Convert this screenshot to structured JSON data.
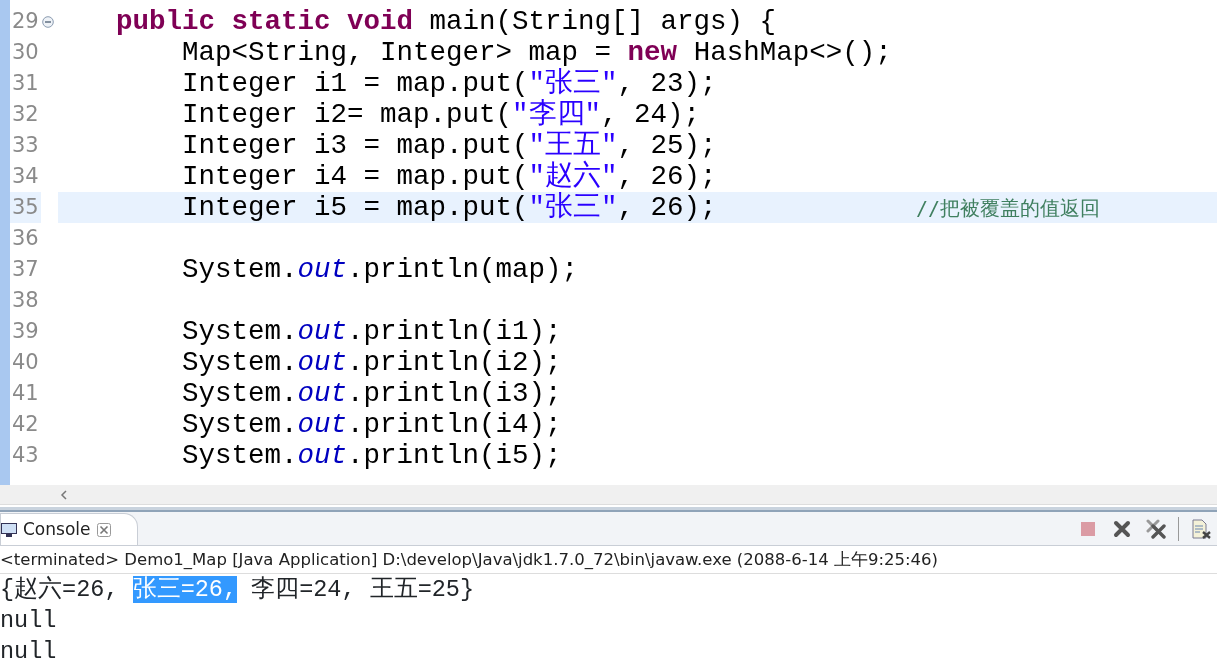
{
  "editor": {
    "lines": [
      {
        "number": "29",
        "expanded": true,
        "current": false,
        "tokens": [
          {
            "kind": "keyword",
            "text": "    public static void"
          },
          {
            "kind": "plain",
            "text": " main(String[] args) {"
          }
        ]
      },
      {
        "number": "30",
        "current": false,
        "tokens": [
          {
            "kind": "plain",
            "text": "        Map<String, Integer> map = "
          },
          {
            "kind": "keyword",
            "text": "new"
          },
          {
            "kind": "plain",
            "text": " HashMap<>();"
          }
        ]
      },
      {
        "number": "31",
        "current": false,
        "tokens": [
          {
            "kind": "plain",
            "text": "        Integer i1 = map.put("
          },
          {
            "kind": "string",
            "text": "\"张三\""
          },
          {
            "kind": "plain",
            "text": ", 23);"
          }
        ]
      },
      {
        "number": "32",
        "current": false,
        "tokens": [
          {
            "kind": "plain",
            "text": "        Integer i2= map.put("
          },
          {
            "kind": "string",
            "text": "\"李四\""
          },
          {
            "kind": "plain",
            "text": ", 24);"
          }
        ]
      },
      {
        "number": "33",
        "current": false,
        "tokens": [
          {
            "kind": "plain",
            "text": "        Integer i3 = map.put("
          },
          {
            "kind": "string",
            "text": "\"王五\""
          },
          {
            "kind": "plain",
            "text": ", 25);"
          }
        ]
      },
      {
        "number": "34",
        "current": false,
        "tokens": [
          {
            "kind": "plain",
            "text": "        Integer i4 = map.put("
          },
          {
            "kind": "string",
            "text": "\"赵六\""
          },
          {
            "kind": "plain",
            "text": ", 26);"
          }
        ]
      },
      {
        "number": "35",
        "current": true,
        "tokens": [
          {
            "kind": "plain",
            "text": "        Integer i5 = map.put("
          },
          {
            "kind": "string",
            "text": "\"张三\""
          },
          {
            "kind": "plain",
            "text": ", 26);"
          }
        ],
        "comment": "//把被覆盖的值返回"
      },
      {
        "number": "36",
        "current": false
      },
      {
        "number": "37",
        "current": false,
        "tokens": [
          {
            "kind": "plain",
            "text": "        System."
          },
          {
            "kind": "field",
            "text": "out"
          },
          {
            "kind": "plain",
            "text": ".println(map);"
          }
        ]
      },
      {
        "number": "38",
        "current": false
      },
      {
        "number": "39",
        "current": false,
        "tokens": [
          {
            "kind": "plain",
            "text": "        System."
          },
          {
            "kind": "field",
            "text": "out"
          },
          {
            "kind": "plain",
            "text": ".println(i1);"
          }
        ]
      },
      {
        "number": "40",
        "current": false,
        "tokens": [
          {
            "kind": "plain",
            "text": "        System."
          },
          {
            "kind": "field",
            "text": "out"
          },
          {
            "kind": "plain",
            "text": ".println(i2);"
          }
        ]
      },
      {
        "number": "41",
        "current": false,
        "tokens": [
          {
            "kind": "plain",
            "text": "        System."
          },
          {
            "kind": "field",
            "text": "out"
          },
          {
            "kind": "plain",
            "text": ".println(i3);"
          }
        ]
      },
      {
        "number": "42",
        "current": false,
        "tokens": [
          {
            "kind": "plain",
            "text": "        System."
          },
          {
            "kind": "field",
            "text": "out"
          },
          {
            "kind": "plain",
            "text": ".println(i4);"
          }
        ]
      },
      {
        "number": "43",
        "current": false,
        "tokens": [
          {
            "kind": "plain",
            "text": "        System."
          },
          {
            "kind": "field",
            "text": "out"
          },
          {
            "kind": "plain",
            "text": ".println(i5);"
          }
        ]
      }
    ]
  },
  "console": {
    "tab": {
      "label": "Console",
      "selected": true
    },
    "toolbar": [
      {
        "kind": "terminate",
        "disabled": true
      },
      {
        "kind": "remove",
        "disabled": false
      },
      {
        "kind": "remove_all",
        "disabled": false
      },
      {
        "kind": "separator"
      },
      {
        "kind": "display",
        "disabled": false
      }
    ],
    "status": "<terminated> Demo1_Map [Java Application] D:\\develop\\Java\\jdk1.7.0_72\\bin\\javaw.exe (2088-6-14 上午9:25:46)",
    "output": [
      {
        "segments": [
          {
            "text": "{赵六=26, ",
            "selected": false
          },
          {
            "text": "张三=26,",
            "selected": true
          },
          {
            "text": " 李四=24, 王五=25}",
            "selected": false
          }
        ]
      },
      {
        "segments": [
          {
            "text": "null",
            "selected": false
          }
        ]
      },
      {
        "segments": [
          {
            "text": "null",
            "selected": false
          }
        ]
      }
    ]
  }
}
